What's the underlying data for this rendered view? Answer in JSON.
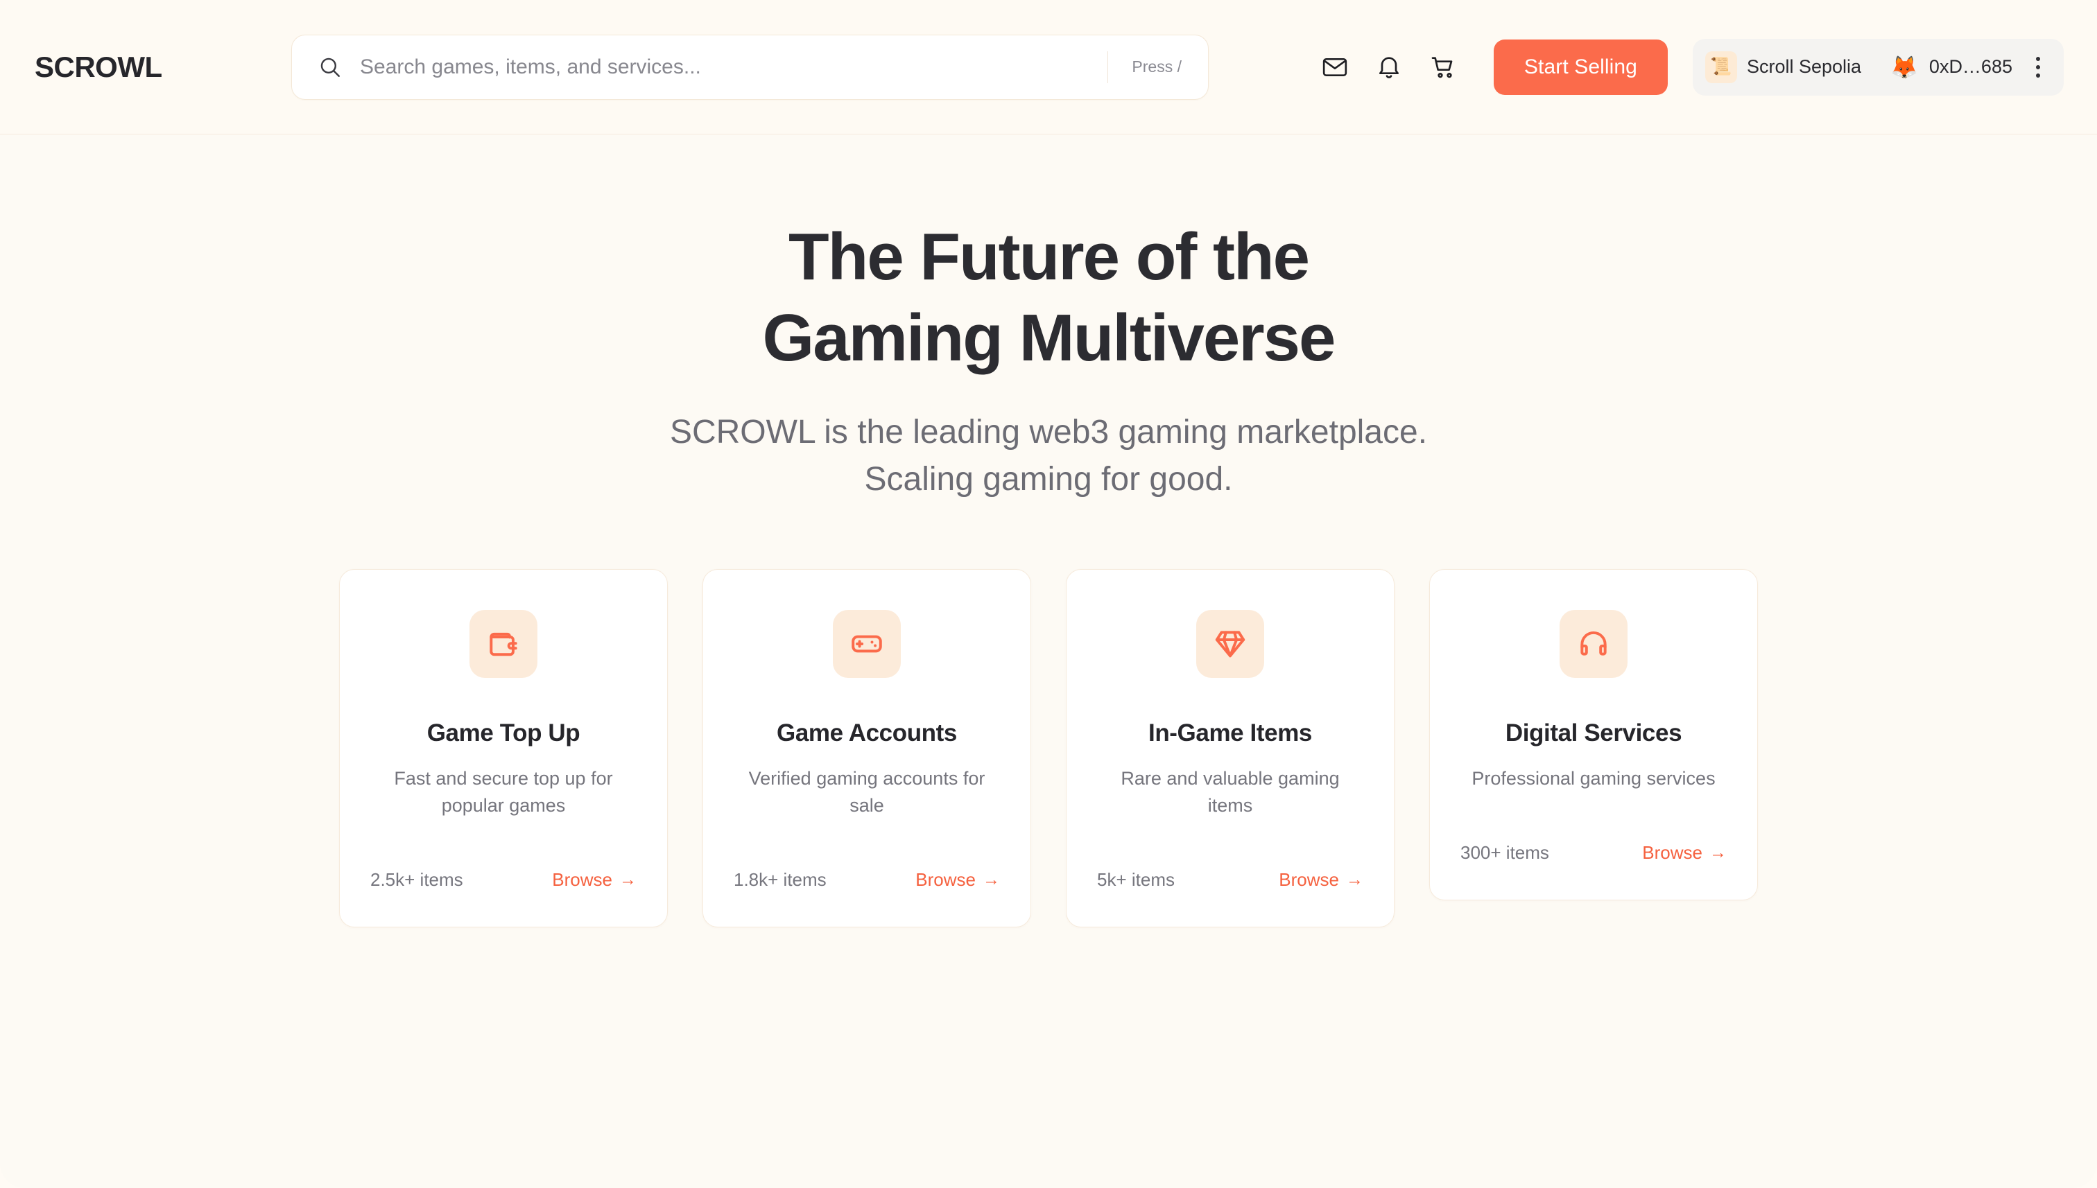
{
  "header": {
    "brand": "SCROWL",
    "search": {
      "placeholder": "Search games, items, and services...",
      "value": "",
      "shortcut_hint": "Press /",
      "icon": "search-icon"
    },
    "actions": [
      {
        "name": "messages",
        "icon": "mail-icon"
      },
      {
        "name": "notifications",
        "icon": "bell-icon"
      },
      {
        "name": "cart",
        "icon": "shopping-cart-icon"
      }
    ],
    "start_selling_label": "Start Selling",
    "wallet": {
      "chain_icon": "scroll-icon",
      "chain_emoji": "📜",
      "chain_label": "Scroll Sepolia",
      "account_icon": "metamask-fox-icon",
      "account_emoji": "🦊",
      "account_label": "0xD…685",
      "menu_icon": "kebab-menu-icon"
    }
  },
  "hero": {
    "title_line1": "The Future of the",
    "title_line2": "Gaming Multiverse",
    "subtitle_line1": "SCROWL is the leading web3 gaming marketplace.",
    "subtitle_line2": "Scaling gaming for good."
  },
  "cards": [
    {
      "icon": "wallet-icon",
      "title": "Game Top Up",
      "description": "Fast and secure top up for popular games",
      "count": "2.5k+ items",
      "browse_label": "Browse",
      "browse_arrow": "→"
    },
    {
      "icon": "gamepad-icon",
      "title": "Game Accounts",
      "description": "Verified gaming accounts for sale",
      "count": "1.8k+ items",
      "browse_label": "Browse",
      "browse_arrow": "→"
    },
    {
      "icon": "diamond-icon",
      "title": "In-Game Items",
      "description": "Rare and valuable gaming items",
      "count": "5k+ items",
      "browse_label": "Browse",
      "browse_arrow": "→"
    },
    {
      "icon": "headphones-icon",
      "title": "Digital Services",
      "description": "Professional gaming services",
      "count": "300+ items",
      "browse_label": "Browse",
      "browse_arrow": "→"
    }
  ],
  "colors": {
    "accent": "#FB6B4B",
    "accent_text": "#F5613F",
    "page_bg": "#FDFAF4",
    "header_bg": "#FEFAF3",
    "card_bg": "#FFFFFF",
    "icon_tile_bg": "#FCEBDA",
    "text_primary": "#26262B",
    "text_muted": "#75757D"
  }
}
